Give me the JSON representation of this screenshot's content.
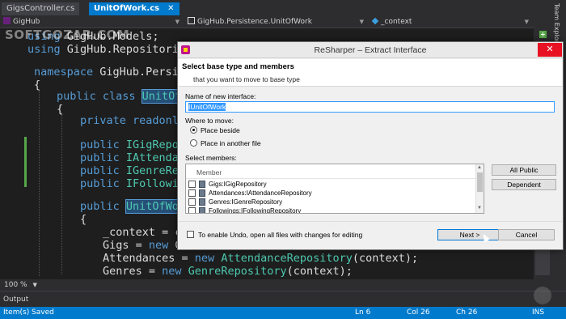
{
  "tabs": [
    {
      "label": "GigsController.cs",
      "active": false
    },
    {
      "label": "UnitOfWork.cs",
      "active": true
    }
  ],
  "nav": {
    "project": "GigHub",
    "namespace": "GigHub.Persistence.UnitOfWork",
    "member": "_context"
  },
  "side_panel": {
    "label": "Team Explorer"
  },
  "code_lines": {
    "l1_kw": "using",
    "l1_rest": " GigHub.Models;",
    "l2_kw": "using",
    "l2_rest": " GigHub.Repositories",
    "l3_kw": "namespace",
    "l3_rest": " GigHub.Persiste",
    "l4_open": "{",
    "l5_kw": "public class ",
    "l5_hl": "UnitOfWo",
    "l6_open": "{",
    "l7_kw": "private readonly",
    "l8_kw": "public ",
    "l8_rest": "IGigReposi",
    "l9_kw": "public ",
    "l9_rest": "IAttendanc",
    "l10_kw": "public ",
    "l10_rest": "IGenreRepo",
    "l11_kw": "public ",
    "l11_rest": "IFollowing",
    "l12_kw": "public ",
    "l12_hl": "UnitOfWork",
    "l13_open": "{",
    "l14": "_context = co",
    "l15_a": "Gigs = ",
    "l15_kw": "new",
    "l15_b": " Gi",
    "l16_a": "Attendances = ",
    "l16_kw": "new",
    "l16_ty": " AttendanceRepository",
    "l16_b": "(context);",
    "l17_a": "Genres = ",
    "l17_kw": "new",
    "l17_ty": " GenreRepository",
    "l17_b": "(context);"
  },
  "zoom": "100 %",
  "output_label": "Output",
  "status": {
    "message": "Item(s) Saved",
    "line": "Ln 6",
    "col": "Col 26",
    "ch": "Ch 26",
    "mode": "INS"
  },
  "dialog": {
    "title": "ReSharper – Extract Interface",
    "header_title": "Select base type and members",
    "header_subtitle": "that you want to move to base type",
    "name_label": "Name of new interface:",
    "name_value": "IUnitOfWork",
    "move_label": "Where to move:",
    "option_beside": "Place beside",
    "option_another": "Place in another file",
    "selected_option": "Place beside",
    "members_label": "Select members:",
    "members_column": "Member",
    "members": [
      {
        "label": "Gigs:IGigRepository",
        "checked": false
      },
      {
        "label": "Attendances:IAttendanceRepository",
        "checked": false
      },
      {
        "label": "Genres:IGenreRepository",
        "checked": false
      },
      {
        "label": "Followings:IFollowingRepository",
        "checked": false
      }
    ],
    "btn_all_public": "All Public",
    "btn_dependent": "Dependent",
    "undo_label": "To enable Undo, open all files with changes for editing",
    "btn_next": "Next >",
    "btn_cancel": "Cancel"
  },
  "watermark": "SOFTGOZAR.COM"
}
